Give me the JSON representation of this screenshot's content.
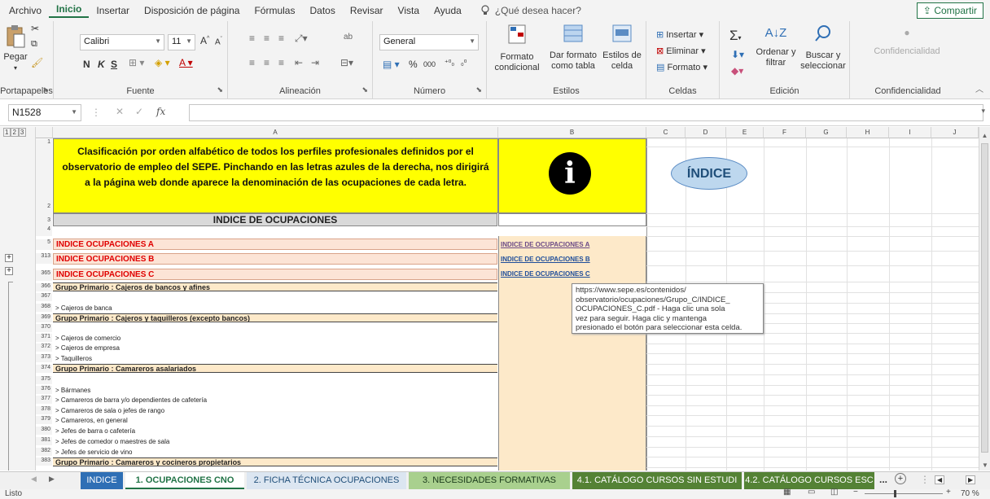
{
  "menu": {
    "items": [
      "Archivo",
      "Inicio",
      "Insertar",
      "Disposición de página",
      "Fórmulas",
      "Datos",
      "Revisar",
      "Vista",
      "Ayuda"
    ],
    "tell_me": "¿Qué desea hacer?",
    "share": "Compartir"
  },
  "ribbon": {
    "clipboard": {
      "paste": "Pegar",
      "label": "Portapapeles"
    },
    "font": {
      "name": "Calibri",
      "size": "11",
      "bold": "N",
      "italic": "K",
      "underline": "S",
      "label": "Fuente"
    },
    "alignment": {
      "label": "Alineación"
    },
    "number": {
      "format": "General",
      "percent": "%",
      "thousands": "000",
      "label": "Número"
    },
    "styles": {
      "conditional": "Formato condicional",
      "as_table": "Dar formato como tabla",
      "cell_styles": "Estilos de celda",
      "label": "Estilos"
    },
    "cells": {
      "insert": "Insertar",
      "delete": "Eliminar",
      "format": "Formato",
      "label": "Celdas"
    },
    "editing": {
      "sort": "Ordenar y filtrar",
      "find": "Buscar y seleccionar",
      "label": "Edición"
    },
    "confidentiality": {
      "button": "Confidencialidad",
      "label": "Confidencialidad"
    }
  },
  "formula_bar": {
    "name_box": "N1528",
    "fx": "fx",
    "value": ""
  },
  "grid": {
    "outline_levels": [
      "1",
      "2",
      "3"
    ],
    "columns": [
      "A",
      "B",
      "C",
      "D",
      "E",
      "F",
      "G",
      "H",
      "I",
      "J"
    ],
    "header_text": "Clasificación por orden alfabético de todos los perfiles profesionales definidos por el observatorio de empleo del SEPE. Pinchando en las letras azules de la derecha, nos dirigirá a la página web donde aparece la denominación de las ocupaciones de cada letra.",
    "info_icon": "i",
    "indice_button": "ÍNDICE",
    "rows": [
      {
        "num": "1",
        "a": "",
        "b": ""
      },
      {
        "num": "2",
        "a": "",
        "b": ""
      },
      {
        "num": "3",
        "a": "INDICE DE OCUPACIONES",
        "b": ""
      },
      {
        "num": "4",
        "a": "",
        "b": ""
      },
      {
        "num": "5",
        "a": "INDICE OCUPACIONES A",
        "b": "INDICE DE OCUPACIONES A"
      },
      {
        "num": "313",
        "a": "INDICE OCUPACIONES B",
        "b": "INDICE DE OCUPACIONES B"
      },
      {
        "num": "365",
        "a": "INDICE OCUPACIONES C",
        "b": "INDICE DE OCUPACIONES C"
      },
      {
        "num": "366",
        "a": "Grupo Primario : Cajeros de bancos y afines",
        "b": ""
      },
      {
        "num": "367",
        "a": "",
        "b": ""
      },
      {
        "num": "368",
        "a": "> Cajeros de banca",
        "b": ""
      },
      {
        "num": "369",
        "a": "Grupo Primario : Cajeros y taquilleros (excepto bancos)",
        "b": ""
      },
      {
        "num": "370",
        "a": "",
        "b": ""
      },
      {
        "num": "371",
        "a": "> Cajeros de comercio",
        "b": ""
      },
      {
        "num": "372",
        "a": "> Cajeros de empresa",
        "b": ""
      },
      {
        "num": "373",
        "a": "> Taquilleros",
        "b": ""
      },
      {
        "num": "374",
        "a": "Grupo Primario : Camareros asalariados",
        "b": ""
      },
      {
        "num": "375",
        "a": "",
        "b": ""
      },
      {
        "num": "376",
        "a": "> Bármanes",
        "b": ""
      },
      {
        "num": "377",
        "a": "> Camareros de barra y/o dependientes de cafetería",
        "b": ""
      },
      {
        "num": "378",
        "a": "> Camareros de sala o jefes de rango",
        "b": ""
      },
      {
        "num": "379",
        "a": "> Camareros, en general",
        "b": ""
      },
      {
        "num": "380",
        "a": "> Jefes de barra o cafetería",
        "b": ""
      },
      {
        "num": "381",
        "a": "> Jefes de comedor o maestres de sala",
        "b": ""
      },
      {
        "num": "382",
        "a": "> Jefes de servicio de vino",
        "b": ""
      },
      {
        "num": "383",
        "a": "Grupo Primario : Camareros y cocineros propietarios",
        "b": ""
      }
    ],
    "tooltip": [
      "https://www.sepe.es/contenidos/",
      "observatorio/ocupaciones/Grupo_C/INDICE_",
      "OCUPACIONES_C.pdf - Haga clic una sola",
      "vez para seguir. Haga clic y mantenga",
      "presionado el botón para seleccionar esta celda."
    ]
  },
  "sheet_tabs": {
    "tabs": [
      "INDICE",
      "1. OCUPACIONES CNO",
      "2. FICHA TÉCNICA OCUPACIONES",
      "3. NECESIDADES FORMATIVAS",
      "4.1. CATÁLOGO CURSOS SIN ESTUDI",
      "4.2. CATÁLOGO CURSOS ESC"
    ],
    "more": "...",
    "add": "+"
  },
  "status": {
    "mode": "Listo",
    "zoom": "70 %"
  },
  "colors": {
    "accent": "#217346",
    "yellow": "#ffff00",
    "salmon": "#fce4d6",
    "peach": "#fde9c9",
    "red_text": "#e00000",
    "link": "#1f4e9a"
  }
}
